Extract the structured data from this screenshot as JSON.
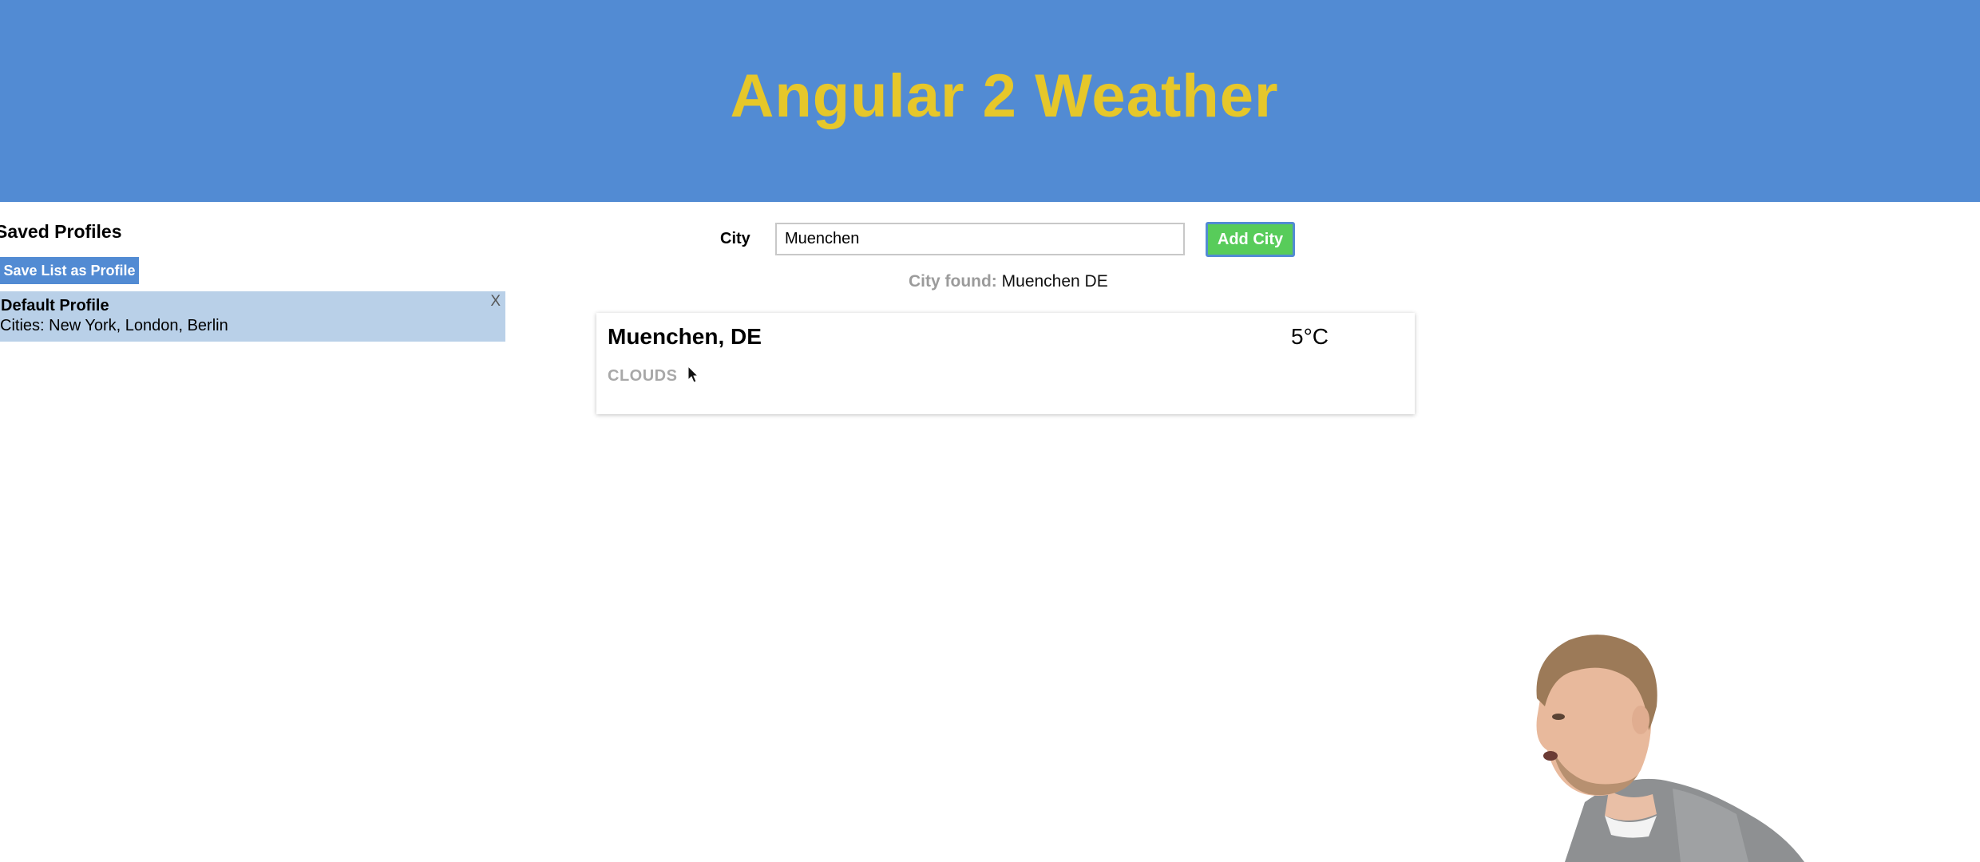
{
  "header": {
    "title": "Angular 2 Weather"
  },
  "sidebar": {
    "title": "Saved Profiles",
    "save_button": "Save List as Profile",
    "profiles": [
      {
        "name": "Default Profile",
        "cities": "Cities: New York, London, Berlin",
        "remove": "X"
      }
    ]
  },
  "search": {
    "label": "City",
    "value": "Muenchen",
    "add_button": "Add City",
    "found_label": "City found:",
    "found_value": "Muenchen DE"
  },
  "weather": [
    {
      "city": "Muenchen, DE",
      "temperature": "5°C",
      "description": "CLOUDS"
    }
  ],
  "colors": {
    "header_bg": "#528bd3",
    "title": "#e6c72a",
    "add_button": "#58cc5a",
    "profile_bg": "#b9d0e8"
  },
  "icons": [
    "mouse-cursor-icon"
  ],
  "overlay": "presenter-webcam"
}
